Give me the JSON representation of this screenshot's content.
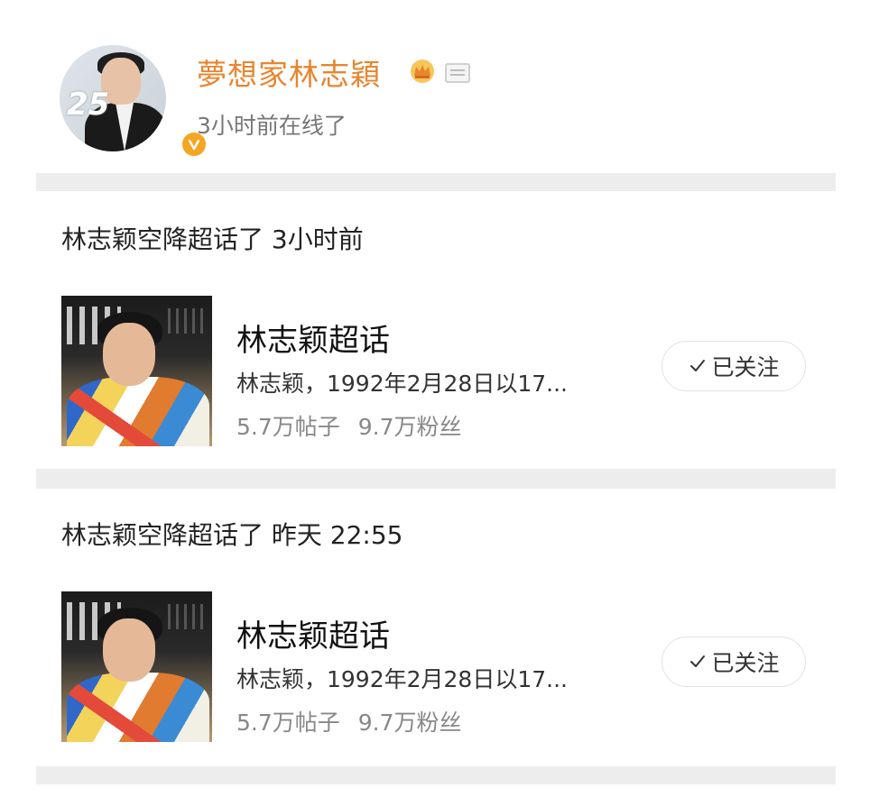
{
  "profile": {
    "username": "夢想家林志穎",
    "status": "3小时前在线了",
    "avatar_badge": "25",
    "icons": [
      "verified-badge-icon",
      "crown-icon",
      "level-icon"
    ],
    "accent_color": "#e8852e"
  },
  "activities": [
    {
      "text": "林志颖空降超话了 3小时前",
      "topic_title": "林志颖超话",
      "topic_desc": "林志颖，1992年2月28日以17...",
      "posts": "5.7万帖子",
      "fans": "9.7万粉丝",
      "follow_label": "已关注"
    },
    {
      "text": "林志颖空降超话了 昨天 22:55",
      "topic_title": "林志颖超话",
      "topic_desc": "林志颖，1992年2月28日以17...",
      "posts": "5.7万帖子",
      "fans": "9.7万粉丝",
      "follow_label": "已关注"
    }
  ]
}
